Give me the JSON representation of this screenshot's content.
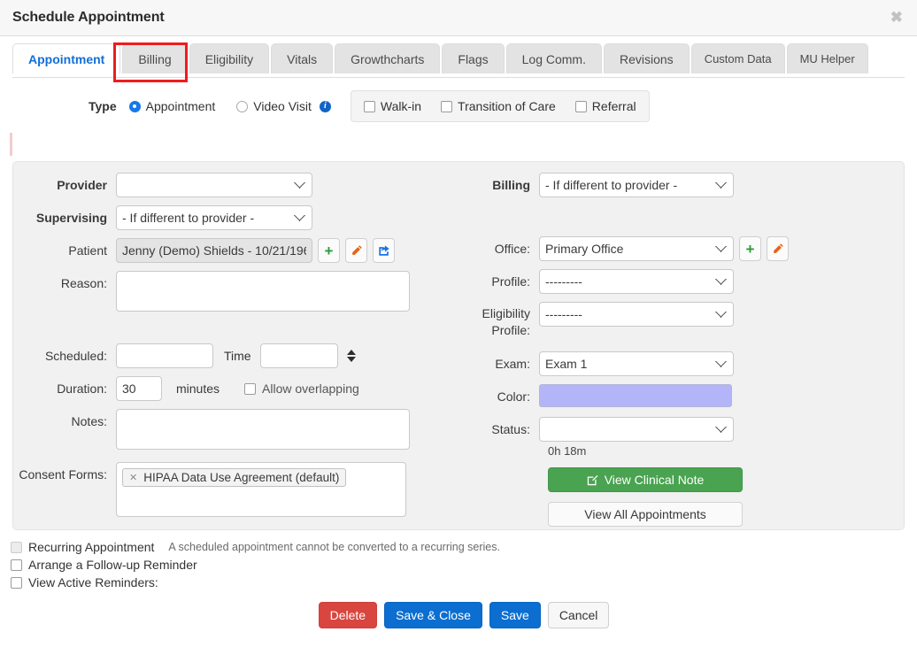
{
  "modal": {
    "title": "Schedule Appointment",
    "close_label": "✖"
  },
  "tabs": [
    {
      "label": "Appointment",
      "active": true
    },
    {
      "label": "Billing",
      "active": false,
      "highlighted": true
    },
    {
      "label": "Eligibility",
      "active": false
    },
    {
      "label": "Vitals",
      "active": false
    },
    {
      "label": "Growthcharts",
      "active": false
    },
    {
      "label": "Flags",
      "active": false
    },
    {
      "label": "Log Comm.",
      "active": false
    },
    {
      "label": "Revisions",
      "active": false
    },
    {
      "label": "Custom Data",
      "active": false,
      "small": true
    },
    {
      "label": "MU Helper",
      "active": false,
      "small": true
    }
  ],
  "type_row": {
    "label": "Type",
    "radio_appointment": "Appointment",
    "radio_video_visit": "Video Visit",
    "info_glyph": "i",
    "checkbox_walkin": "Walk-in",
    "checkbox_transition": "Transition of Care",
    "checkbox_referral": "Referral"
  },
  "left": {
    "provider_label": "Provider",
    "provider_value": "",
    "supervising_label": "Supervising",
    "supervising_value": "- If different to provider -",
    "patient_label": "Patient",
    "patient_value": "Jenny (Demo) Shields - 10/21/196",
    "patient_add_icon": "plus-icon",
    "patient_edit_icon": "pencil-icon",
    "patient_open_icon": "external-link-icon",
    "reason_label": "Reason:",
    "reason_value": "",
    "scheduled_label": "Scheduled:",
    "scheduled_value": "",
    "time_label": "Time",
    "time_value": "",
    "duration_label": "Duration:",
    "duration_value": "30",
    "minutes_label": "minutes",
    "allow_overlapping_label": "Allow overlapping",
    "notes_label": "Notes:",
    "notes_value": "",
    "consent_label": "Consent Forms:",
    "consent_chip": "HIPAA Data Use Agreement (default)",
    "consent_chip_remove": "✕"
  },
  "right": {
    "billing_label": "Billing",
    "billing_value": "- If different to provider -",
    "office_label": "Office:",
    "office_value": "Primary Office",
    "office_add_icon": "plus-icon",
    "office_edit_icon": "pencil-icon",
    "profile_label": "Profile:",
    "profile_value": "---------",
    "eligibility_label": "Eligibility Profile:",
    "eligibility_value": "---------",
    "exam_label": "Exam:",
    "exam_value": "Exam 1",
    "color_label": "Color:",
    "color_value": "#b4b4f9",
    "status_label": "Status:",
    "status_value": "",
    "duration_text": "0h 18m",
    "view_clinical_note": "View Clinical Note",
    "view_clinical_note_icon": "edit-note-icon",
    "view_all_appointments": "View All Appointments"
  },
  "bottom": {
    "recurring_label": "Recurring Appointment",
    "recurring_hint": "A scheduled appointment cannot be converted to a recurring series.",
    "followup_label": "Arrange a Follow-up Reminder",
    "active_reminders_label": "View Active Reminders:",
    "delete_label": "Delete",
    "save_close_label": "Save & Close",
    "save_label": "Save",
    "cancel_label": "Cancel"
  },
  "colors": {
    "accent_blue": "#126fd6",
    "primary_button": "#0b6ed0",
    "danger_button": "#d9453f",
    "success_button": "#49a350",
    "highlight_box": "#ee1c1c"
  }
}
